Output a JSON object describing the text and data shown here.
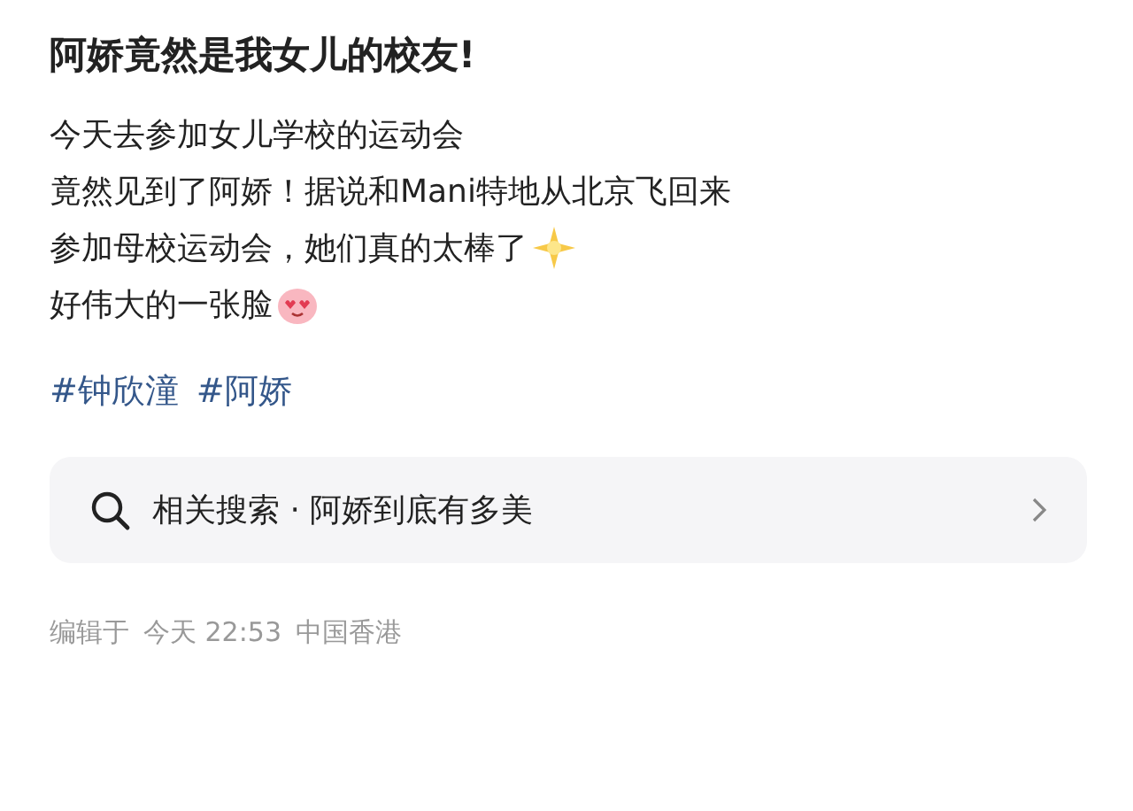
{
  "post": {
    "title": "阿娇竟然是我女儿的校友!",
    "lines": [
      {
        "text": "今天去参加女儿学校的运动会"
      },
      {
        "text": "竟然见到了阿娇！据说和Mani特地从北京飞回来"
      },
      {
        "text": "参加母校运动会，她们真的太棒了",
        "kind": "sparkle"
      },
      {
        "text": "好伟大的一张脸",
        "kind": "emoji"
      }
    ],
    "hashtags": [
      "#钟欣潼",
      "#阿娇"
    ],
    "related_search": {
      "label": "相关搜索 · 阿娇到底有多美"
    },
    "footer": [
      "编辑于",
      "今天 22:53",
      "中国香港"
    ]
  }
}
